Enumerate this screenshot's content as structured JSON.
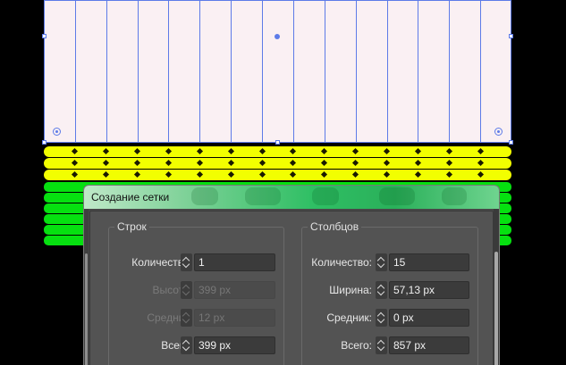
{
  "dialog": {
    "title": "Создание сетки",
    "rows": {
      "label": "Строк",
      "count_label": "Количество:",
      "count_value": "1",
      "height_label": "Высота:",
      "height_value": "399 px",
      "gutter_label": "Средник:",
      "gutter_value": "12 px",
      "total_label": "Всего:",
      "total_value": "399 px"
    },
    "columns": {
      "label": "Столбцов",
      "count_label": "Количество:",
      "count_value": "15",
      "width_label": "Ширина:",
      "width_value": "57,13 px",
      "gutter_label": "Средник:",
      "gutter_value": "0 px",
      "total_label": "Всего:",
      "total_value": "857 px"
    }
  },
  "colors": {
    "artboard": "#faf0f3",
    "guide": "#5d7be8",
    "yellow": "#f2ff00",
    "green": "#06e010",
    "titlebar_accent": "#2fbf64"
  }
}
